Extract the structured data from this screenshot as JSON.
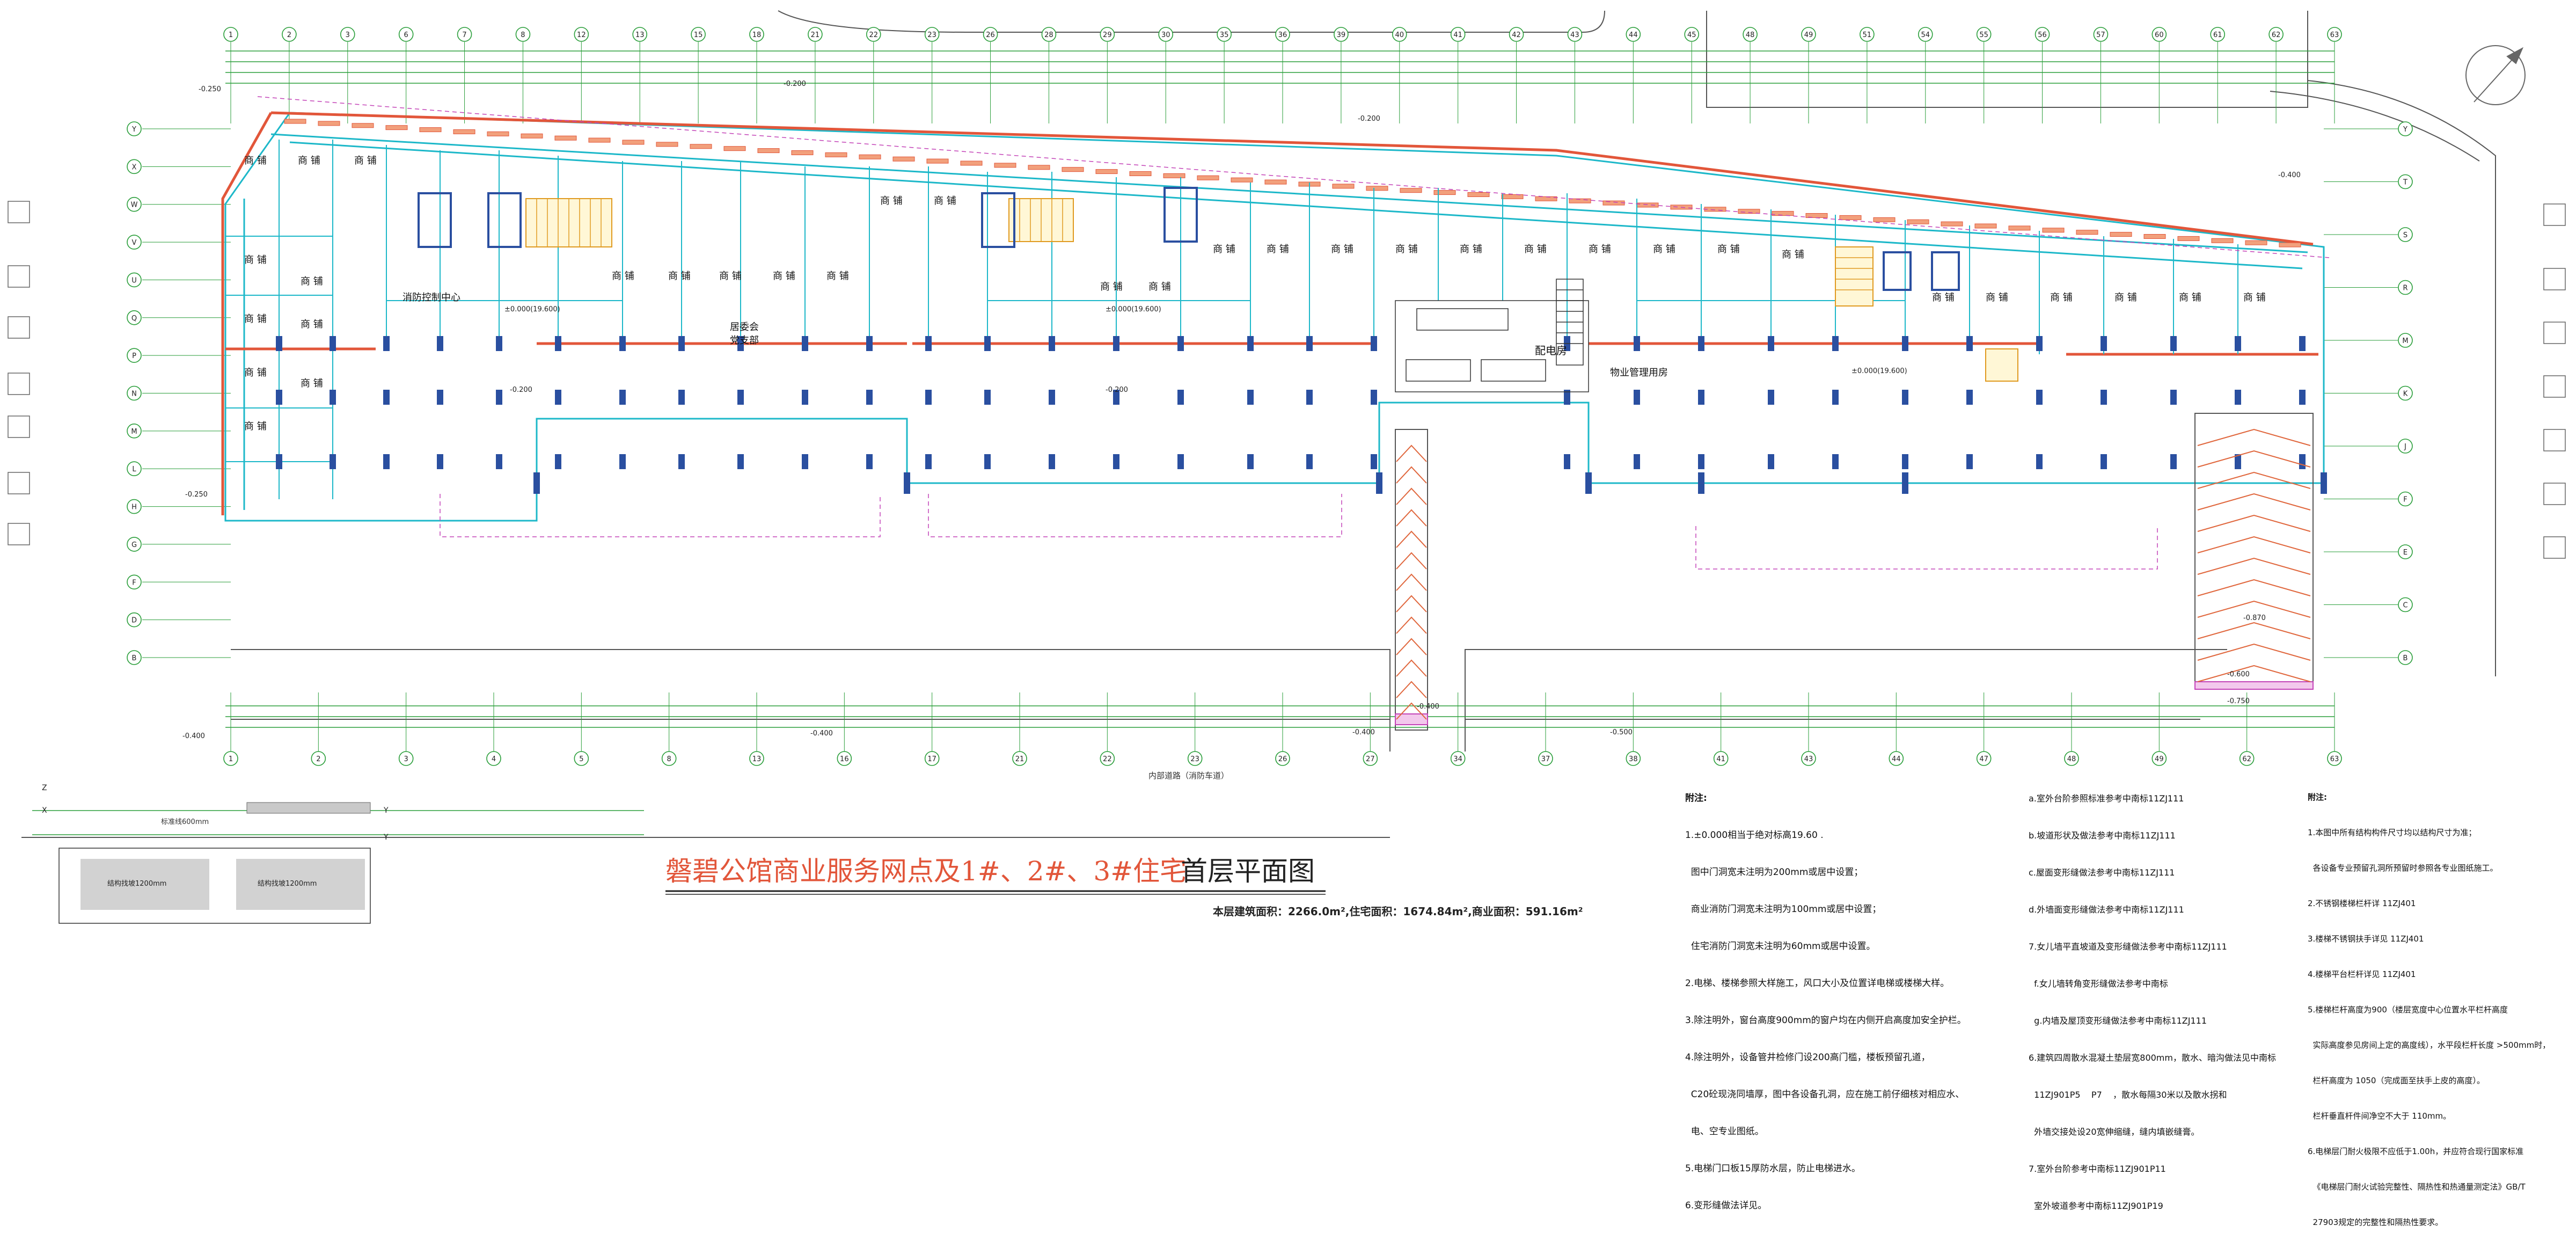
{
  "title": "磐碧公馆商业服务网点及1#、2#、3#住宅",
  "title_suffix": "首层平面图",
  "areas": {
    "building_area_label": "本层建筑面积：",
    "building_area": "2266.0m²",
    "residential_label": ",住宅面积：",
    "residential_area": "1674.84m²",
    "commercial_label": ",商业面积：",
    "commercial_area": "591.16m²"
  },
  "grid_axes": {
    "top_numbers": [
      "1",
      "2",
      "3",
      "6",
      "7",
      "8",
      "12",
      "13",
      "15",
      "18",
      "21",
      "22",
      "23",
      "26",
      "28",
      "29",
      "30",
      "35",
      "36",
      "39",
      "40",
      "41",
      "42",
      "43",
      "44",
      "45",
      "48",
      "49",
      "51",
      "54",
      "55",
      "56",
      "57",
      "60",
      "61",
      "62",
      "63"
    ],
    "bottom_numbers": [
      "1",
      "2",
      "3",
      "4",
      "5",
      "8",
      "13",
      "16",
      "17",
      "21",
      "22",
      "23",
      "26",
      "27",
      "34",
      "37",
      "38",
      "41",
      "43",
      "44",
      "47",
      "48",
      "49",
      "62",
      "63"
    ],
    "left_letters": [
      "Y",
      "X",
      "W",
      "V",
      "U",
      "Q",
      "P",
      "N",
      "M",
      "L",
      "H",
      "G",
      "F",
      "D",
      "B"
    ],
    "right_letters": [
      "Y",
      "T",
      "S",
      "R",
      "M",
      "K",
      "J",
      "F",
      "E",
      "C",
      "B"
    ]
  },
  "room_labels": {
    "shop": "商 铺",
    "fire_control": "消防控制中心",
    "party_center": "居委会\n党支部",
    "power_room": "配电房",
    "property_office": "物业管理用房"
  },
  "levels": {
    "minus_250": "-0.250",
    "minus_200": "-0.200",
    "minus_400": "-0.400",
    "minus_500": "-0.500",
    "minus_600": "-0.600",
    "minus_870": "-0.870",
    "minus_750": "-0.750",
    "zero": "±0.000(19.600)"
  },
  "legend_small": {
    "label1": "结构找坡1200mm",
    "label2": "结构找坡1200mm",
    "label3": "标准线600mm"
  },
  "road_label": "内部道路（消防车道）",
  "notes_left": {
    "heading": "附注:",
    "lines": [
      "1.±0.000相当于绝对标高19.60 .",
      "  图中门洞宽未注明为200mm或居中设置；",
      "  商业消防门洞宽未注明为100mm或居中设置；",
      "  住宅消防门洞宽未注明为60mm或居中设置。",
      "2.电梯、楼梯参照大样施工，风口大小及位置详电梯或楼梯大样。",
      "3.除注明外，窗台高度900mm的窗户均在内侧开启高度加安全护栏。",
      "4.除注明外，设备管井检修门设200高门槛，楼板预留孔道，",
      "  C20砼现浇同墙厚，图中各设备孔洞，应在施工前仔细核对相应水、",
      "  电、空专业图纸。",
      "5.电梯门口板15厚防水层，防止电梯进水。",
      "6.变形缝做法详见。"
    ]
  },
  "notes_mid": {
    "lines": [
      "a.室外台阶参照标准参考中南标11ZJ111",
      "b.坡道形状及做法参考中南标11ZJ111",
      "c.屋面变形缝做法参考中南标11ZJ111",
      "d.外墙面变形缝做法参考中南标11ZJ111",
      "7.女儿墙平直坡道及变形缝做法参考中南标11ZJ111",
      "  f.女儿墙转角变形缝做法参考中南标",
      "  g.内墙及屋顶变形缝做法参考中南标11ZJ111",
      "6.建筑四周散水混凝土垫层宽800mm，散水、暗沟做法见中南标",
      "  11ZJ901P5    P7    ，散水每隔30米以及散水拐和",
      "  外墙交接处设20宽伸缩缝，缝内填嵌缝膏。",
      "7.室外台阶参考中南标11ZJ901P11",
      "  室外坡道参考中南标11ZJ901P19"
    ]
  },
  "notes_right": {
    "heading": "附注:",
    "lines": [
      "1.本图中所有结构构件尺寸均以结构尺寸为准；",
      "  各设备专业预留孔洞所预留时参照各专业图纸施工。",
      "2.不锈钢楼梯栏杆详 11ZJ401",
      "3.楼梯不锈钢扶手详见 11ZJ401",
      "4.楼梯平台栏杆详见 11ZJ401",
      "5.楼梯栏杆高度为900（楼层宽度中心位置水平栏杆高度",
      "  实际高度参见房间上定的高度线），水平段栏杆长度 >500mm时，",
      "  栏杆高度为 1050（完成面至扶手上皮的高度）。",
      "  栏杆垂直杆件间净空不大于 110mm。",
      "6.电梯层门耐火极限不应低于1.00h，并应符合现行国家标准",
      "  《电梯层门耐火试验完整性、隔热性和热通量测定法》GB/T",
      "  27903规定的完整性和隔热性要求。"
    ]
  }
}
